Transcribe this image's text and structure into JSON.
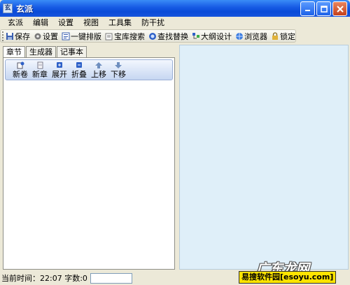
{
  "window": {
    "title": "玄派",
    "app_icon_text": "玄"
  },
  "menu": [
    "玄派",
    "编辑",
    "设置",
    "视图",
    "工具集",
    "防干扰"
  ],
  "toolbar": {
    "items": [
      {
        "label": "保存",
        "icon": "save-icon"
      },
      {
        "label": "设置",
        "icon": "gear-icon"
      },
      {
        "label": "一键排版",
        "icon": "format-icon"
      },
      {
        "label": "宝库搜索",
        "icon": "library-search-icon"
      },
      {
        "label": "查找替换",
        "icon": "find-replace-icon"
      },
      {
        "label": "大纲设计",
        "icon": "outline-icon"
      },
      {
        "label": "浏览器",
        "icon": "browser-icon"
      },
      {
        "label": "锁定",
        "icon": "lock-icon"
      }
    ]
  },
  "left": {
    "tabs": [
      "章节",
      "生成器",
      "记事本"
    ],
    "active_tab": "章节",
    "chapter_buttons": [
      {
        "label": "新卷",
        "icon": "new-volume-icon"
      },
      {
        "label": "新章",
        "icon": "new-chapter-icon"
      },
      {
        "label": "展开",
        "icon": "expand-icon"
      },
      {
        "label": "折叠",
        "icon": "collapse-icon"
      },
      {
        "label": "上移",
        "icon": "move-up-icon"
      },
      {
        "label": "下移",
        "icon": "move-down-icon"
      }
    ]
  },
  "status": {
    "text": "当前时间：22:07 字数:0"
  },
  "watermark": {
    "top": "广东龙网",
    "bottom": "易搜软件园[esoyu.com]"
  },
  "colors": {
    "title_bar": "#1659e4",
    "right_panel": "#dfeff9",
    "watermark_bg": "#ffe400"
  }
}
